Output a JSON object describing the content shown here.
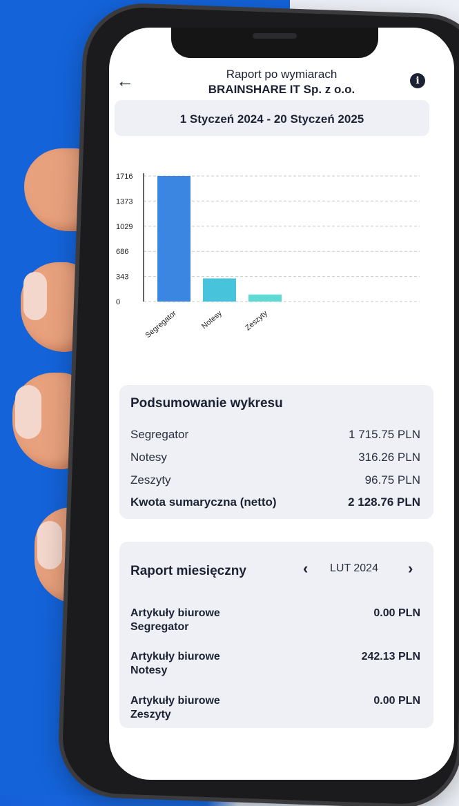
{
  "header": {
    "title": "Raport po wymiarach",
    "subtitle": "BRAINSHARE IT Sp. z o.o.",
    "back_icon": "arrow-left-icon",
    "info_icon": "info-icon"
  },
  "date_range": "1 Styczeń 2024 - 20 Styczeń 2025",
  "chart_data": {
    "type": "bar",
    "categories": [
      "Segregator",
      "Notesy",
      "Zeszyty"
    ],
    "values": [
      1715.75,
      316.26,
      96.75
    ],
    "y_ticks": [
      "1716",
      "1373",
      "1029",
      "686",
      "343",
      "0"
    ],
    "ylim": [
      0,
      1716
    ],
    "colors": [
      "#3a86e0",
      "#47c3db",
      "#5fd9d2"
    ],
    "grid": true
  },
  "summary": {
    "title": "Podsumowanie wykresu",
    "rows": [
      {
        "label": "Segregator",
        "value": "1 715.75  PLN"
      },
      {
        "label": "Notesy",
        "value": "316.26  PLN"
      },
      {
        "label": "Zeszyty",
        "value": "96.75  PLN"
      }
    ],
    "total": {
      "label": "Kwota sumaryczna (netto)",
      "value": "2 128.76  PLN"
    }
  },
  "monthly": {
    "title": "Raport miesięczny",
    "month": "LUT 2024",
    "prev_icon": "chevron-left-icon",
    "next_icon": "chevron-right-icon",
    "rows": [
      {
        "category": "Artykuły biurowe",
        "item": "Segregator",
        "value": "0.00  PLN"
      },
      {
        "category": "Artykuły biurowe",
        "item": "Notesy",
        "value": "242.13  PLN"
      },
      {
        "category": "Artykuły biurowe",
        "item": "Zeszyty",
        "value": "0.00  PLN"
      }
    ]
  }
}
